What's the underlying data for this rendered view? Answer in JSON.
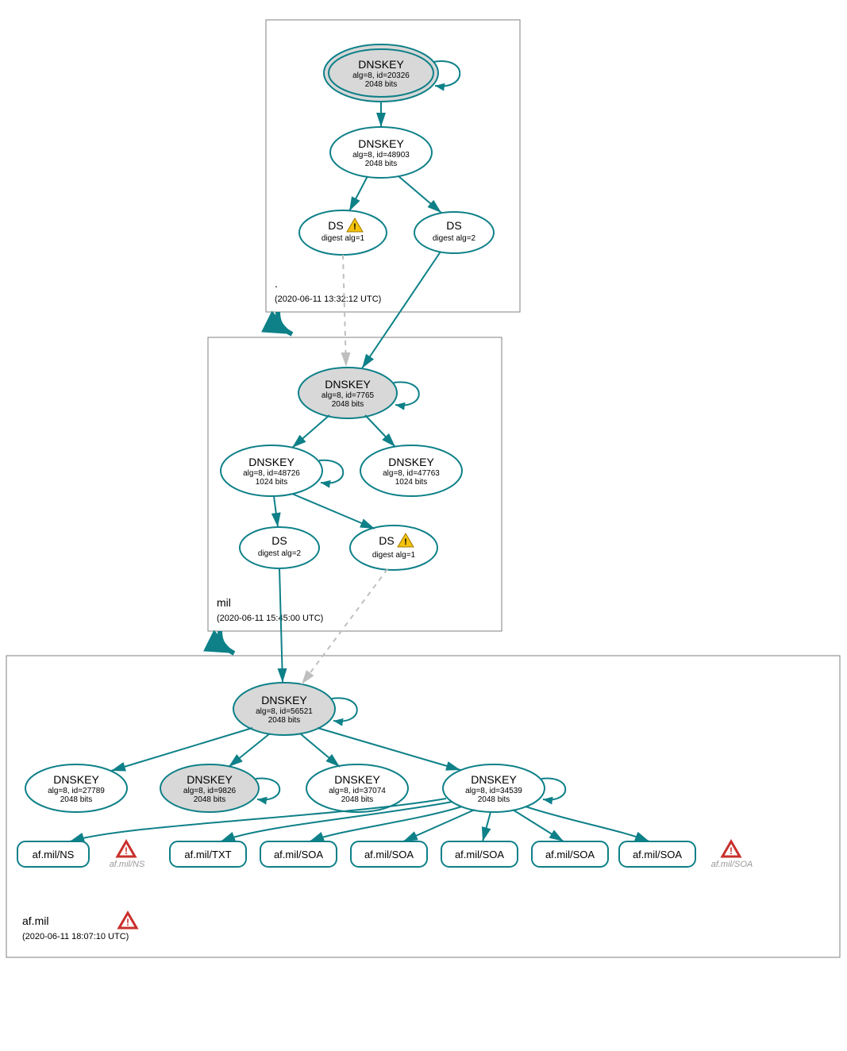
{
  "colors": {
    "teal": "#0e8088",
    "grayNode": "#d8d8d8",
    "zoneBorder": "#808080",
    "dashed": "#bfbfbf",
    "warnFill": "#f4c20d",
    "errStroke": "#c9302c"
  },
  "zones": {
    "root": {
      "label": ".",
      "timestamp": "(2020-06-11 13:32:12 UTC)"
    },
    "mil": {
      "label": "mil",
      "timestamp": "(2020-06-11 15:45:00 UTC)"
    },
    "afmil": {
      "label": "af.mil",
      "timestamp": "(2020-06-11 18:07:10 UTC)"
    }
  },
  "nodes": {
    "root_ksk": {
      "title": "DNSKEY",
      "alg": "alg=8, id=20326",
      "bits": "2048 bits"
    },
    "root_zsk": {
      "title": "DNSKEY",
      "alg": "alg=8, id=48903",
      "bits": "2048 bits"
    },
    "root_ds1": {
      "title": "DS",
      "sub": "digest alg=1"
    },
    "root_ds2": {
      "title": "DS",
      "sub": "digest alg=2"
    },
    "mil_ksk": {
      "title": "DNSKEY",
      "alg": "alg=8, id=7765",
      "bits": "2048 bits"
    },
    "mil_zsk1": {
      "title": "DNSKEY",
      "alg": "alg=8, id=48726",
      "bits": "1024 bits"
    },
    "mil_zsk2": {
      "title": "DNSKEY",
      "alg": "alg=8, id=47763",
      "bits": "1024 bits"
    },
    "mil_ds2": {
      "title": "DS",
      "sub": "digest alg=2"
    },
    "mil_ds1": {
      "title": "DS",
      "sub": "digest alg=1"
    },
    "af_ksk": {
      "title": "DNSKEY",
      "alg": "alg=8, id=56521",
      "bits": "2048 bits"
    },
    "af_k1": {
      "title": "DNSKEY",
      "alg": "alg=8, id=27789",
      "bits": "2048 bits"
    },
    "af_k2": {
      "title": "DNSKEY",
      "alg": "alg=8, id=9826",
      "bits": "2048 bits"
    },
    "af_k3": {
      "title": "DNSKEY",
      "alg": "alg=8, id=37074",
      "bits": "2048 bits"
    },
    "af_k4": {
      "title": "DNSKEY",
      "alg": "alg=8, id=34539",
      "bits": "2048 bits"
    }
  },
  "records": {
    "r1": "af.mil/NS",
    "rw1": "af.mil/NS",
    "r2": "af.mil/TXT",
    "r3": "af.mil/SOA",
    "r4": "af.mil/SOA",
    "r5": "af.mil/SOA",
    "r6": "af.mil/SOA",
    "r7": "af.mil/SOA",
    "rw2": "af.mil/SOA"
  }
}
